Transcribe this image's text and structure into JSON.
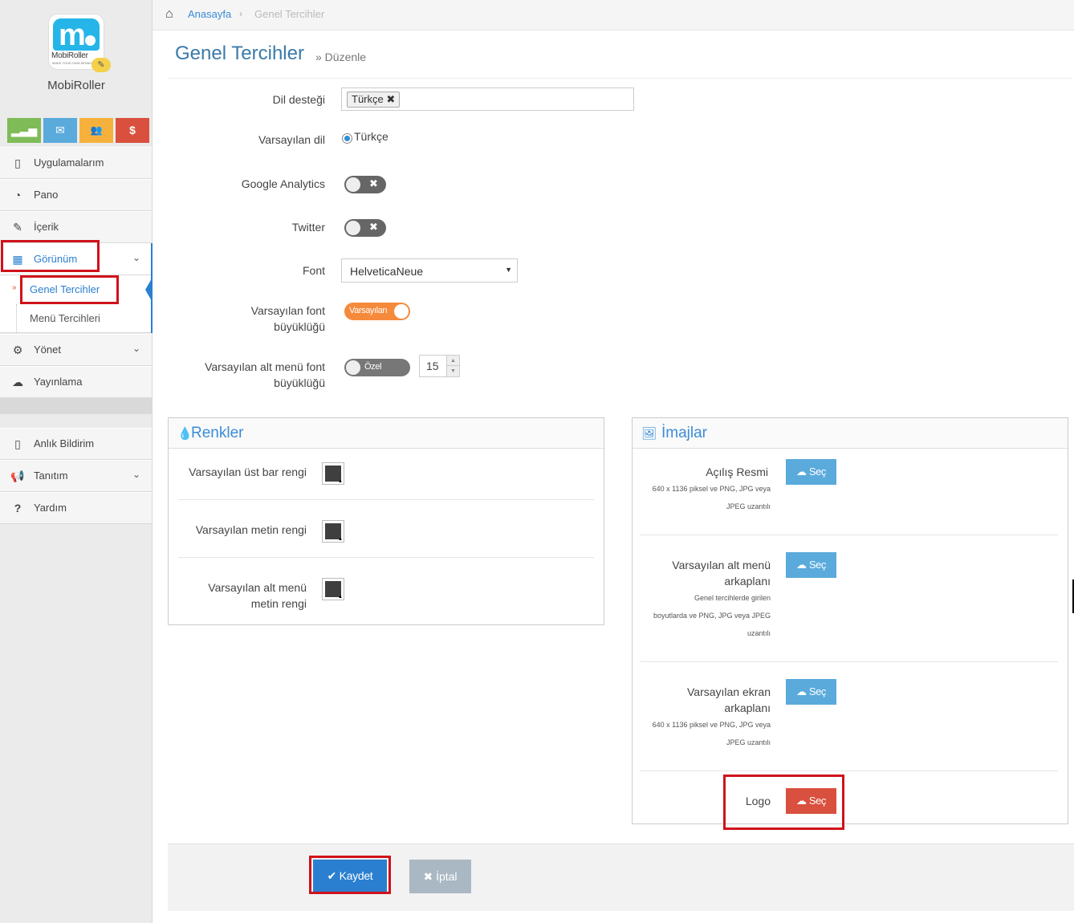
{
  "app": {
    "logo_text": "MobiRoller",
    "logo_subtext": "MAKE YOUR OWN MOBILE",
    "name": "MobiRoller"
  },
  "quick_actions": [
    {
      "icon": "signal-icon",
      "glyph": "▂▃▅",
      "color": "#7fbb57"
    },
    {
      "icon": "envelope-icon",
      "glyph": "✉",
      "color": "#5aaadc"
    },
    {
      "icon": "users-icon",
      "glyph": "👥",
      "color": "#f6b13c"
    },
    {
      "icon": "dollar-icon",
      "glyph": "$",
      "color": "#d9503e"
    }
  ],
  "sidebar": {
    "items": [
      {
        "label": "Uygulamalarım",
        "icon": "mobile-icon"
      },
      {
        "label": "Pano",
        "icon": "dashboard-icon"
      },
      {
        "label": "İçerik",
        "icon": "edit-icon"
      },
      {
        "label": "Görünüm",
        "icon": "grid-icon"
      },
      {
        "label": "Yönet",
        "icon": "gears-icon"
      },
      {
        "label": "Yayınlama",
        "icon": "cloud-upload-icon"
      }
    ],
    "subitems": [
      {
        "label": "Genel Tercihler"
      },
      {
        "label": "Menü Tercihleri"
      }
    ],
    "bottom_items": [
      {
        "label": "Anlık Bildirim",
        "icon": "mobile-icon"
      },
      {
        "label": "Tanıtım",
        "icon": "bullhorn-icon"
      },
      {
        "label": "Yardım",
        "icon": "question-icon"
      }
    ]
  },
  "breadcrumb": {
    "home": "Anasayfa",
    "current": "Genel Tercihler"
  },
  "page": {
    "title": "Genel Tercihler",
    "subtitle": "» Düzenle"
  },
  "form": {
    "language_support": {
      "label": "Dil desteği",
      "tag": "Türkçe ✖"
    },
    "default_language": {
      "label": "Varsayılan dil",
      "value": "Türkçe"
    },
    "google_analytics": {
      "label": "Google Analytics",
      "state": "✖"
    },
    "twitter": {
      "label": "Twitter",
      "state": "✖"
    },
    "font": {
      "label": "Font",
      "value": "HelveticaNeue"
    },
    "default_font_size": {
      "label1": "Varsayılan font",
      "label2": "büyüklüğü",
      "toggle": "Varsayılan"
    },
    "submenu_font_size": {
      "label1": "Varsayılan alt menü font",
      "label2": "büyüklüğü",
      "toggle": "Özel",
      "value": "15"
    }
  },
  "colors_panel": {
    "title": "Renkler",
    "rows": [
      {
        "label": "Varsayılan üst bar rengi"
      },
      {
        "label": "Varsayılan metin rengi"
      },
      {
        "label1": "Varsayılan alt menü",
        "label2": "metin rengi"
      }
    ]
  },
  "images_panel": {
    "title": "İmajlar",
    "button": "Seç",
    "rows": [
      {
        "label": "Açılış Resmi",
        "hint1": "640 x 1136 piksel ve PNG, JPG veya",
        "hint2": "JPEG uzantılı"
      },
      {
        "label1": "Varsayılan alt menü",
        "label2": "arkaplanı",
        "hint1": "Genel tercihlerde girilen",
        "hint2": "boyutlarda ve PNG, JPG veya JPEG",
        "hint3": "uzantılı"
      },
      {
        "label1": "Varsayılan ekran",
        "label2": "arkaplanı",
        "hint1": "640 x 1136 piksel ve PNG, JPG veya",
        "hint2": "JPEG uzantılı"
      },
      {
        "label": "Logo"
      }
    ]
  },
  "actions": {
    "save": "✔ Kaydet",
    "cancel": "✖ İptal"
  },
  "colors": {
    "accent": "#3b8cd8",
    "save": "#2a7fd0",
    "danger": "#d9503e",
    "highlight": "#d0121b"
  }
}
